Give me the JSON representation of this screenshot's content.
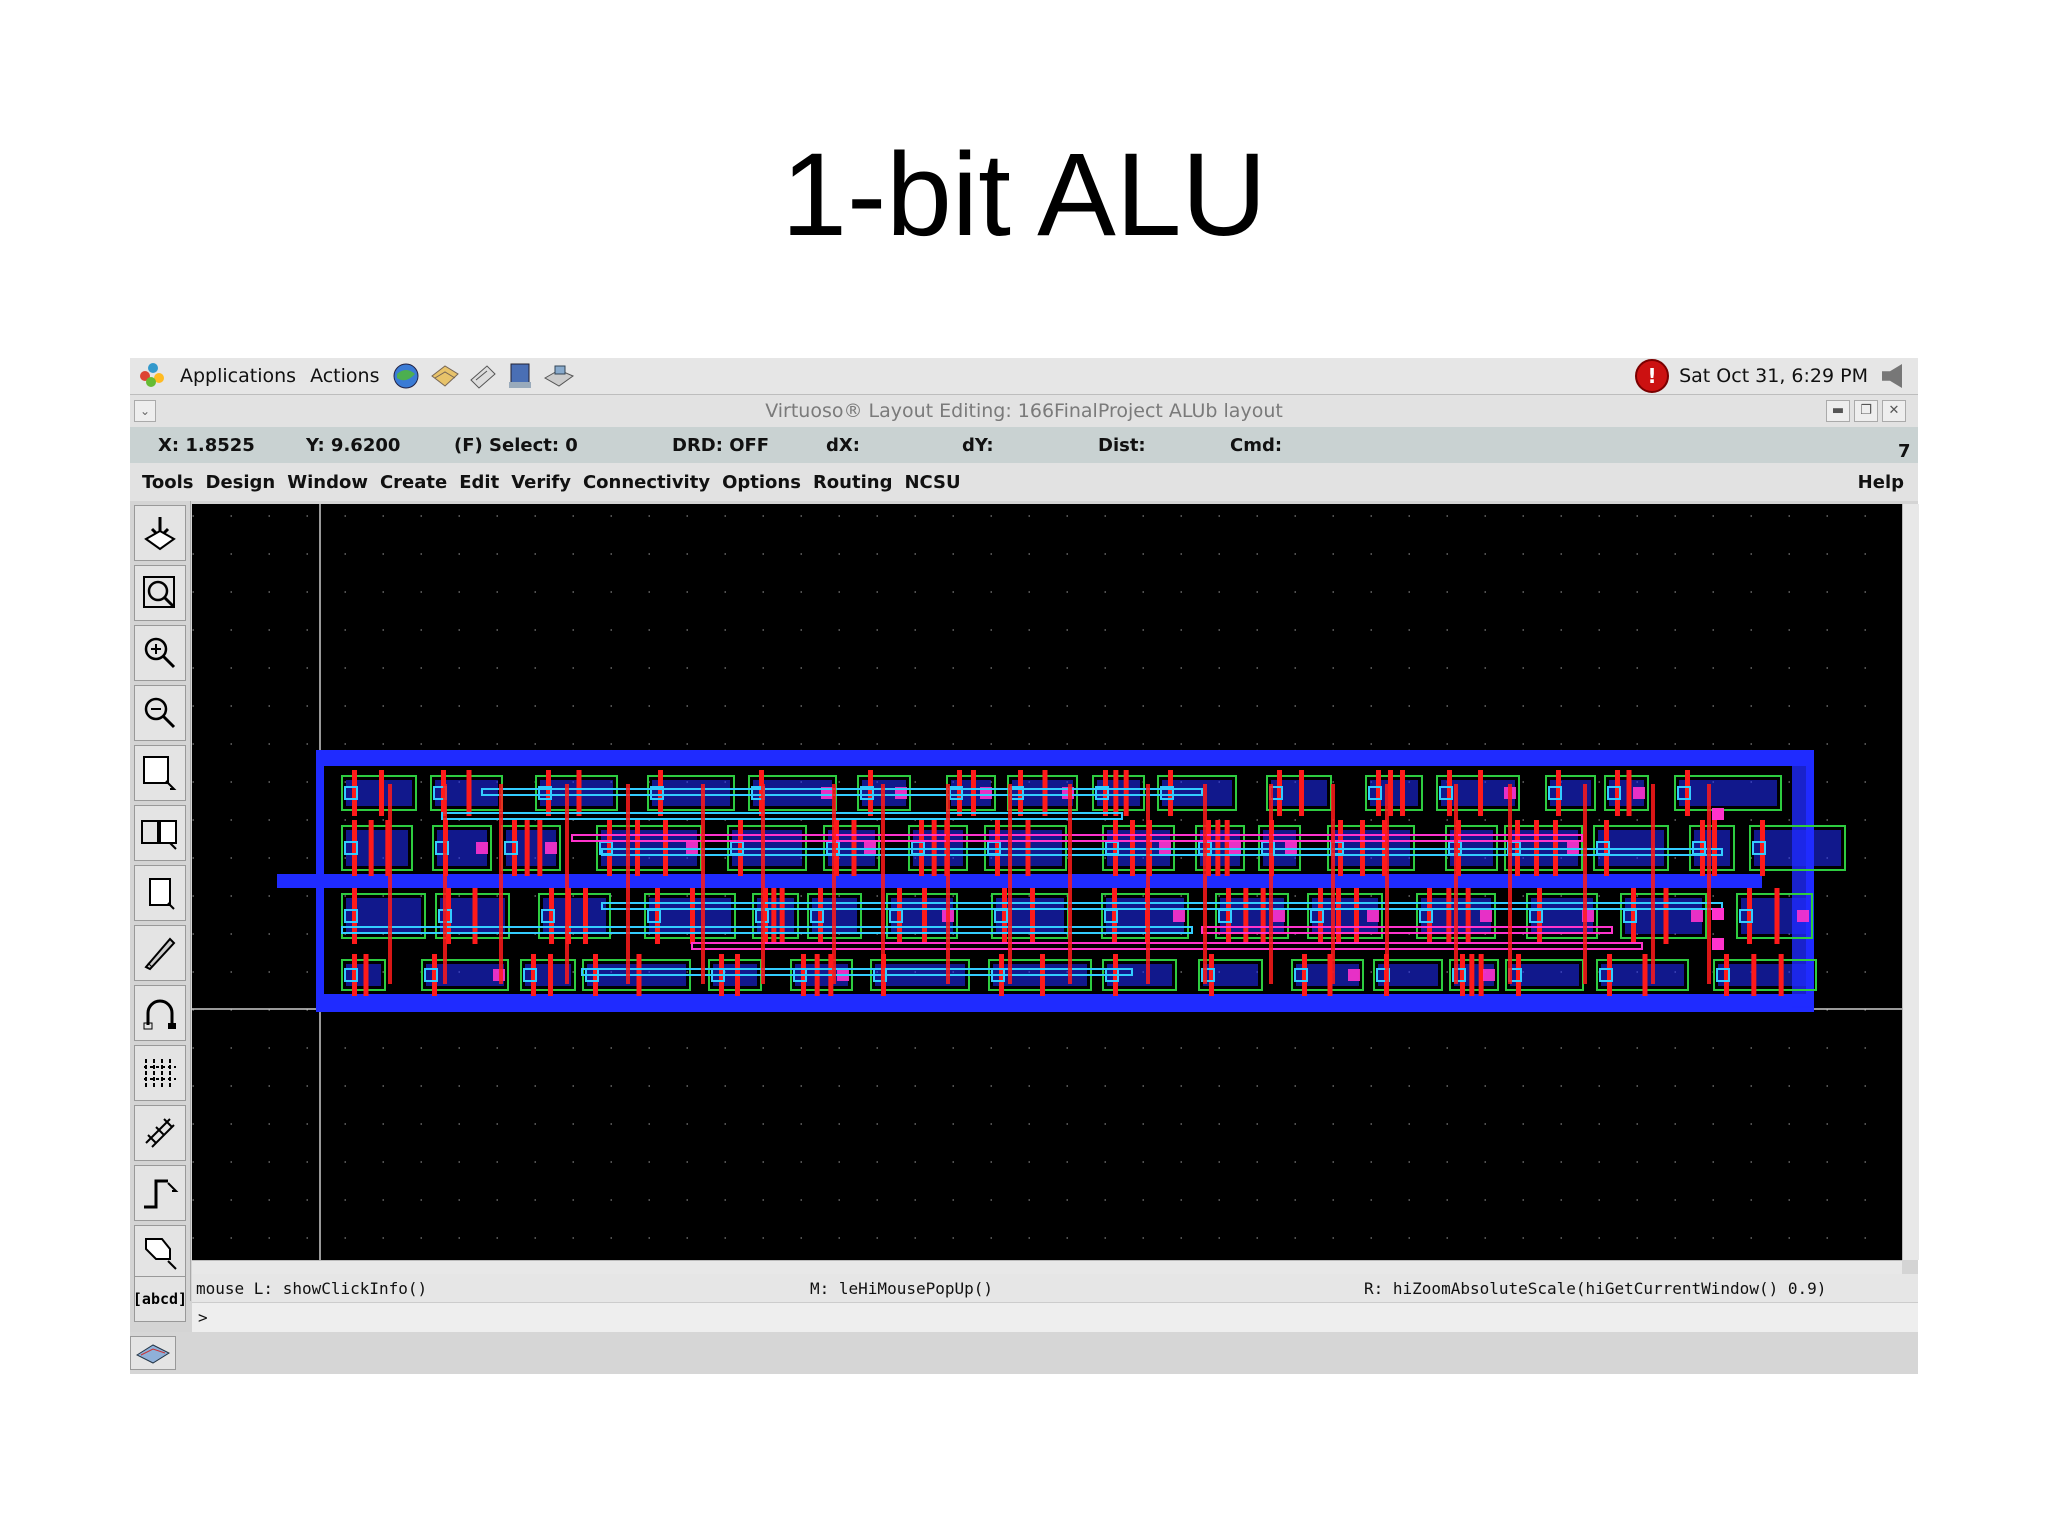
{
  "slide": {
    "title": "1-bit ALU"
  },
  "panel": {
    "applications_label": "Applications",
    "actions_label": "Actions",
    "launchers": [
      "browser-icon",
      "mail-icon",
      "notes-icon",
      "editor-icon",
      "network-icon"
    ],
    "clock": "Sat Oct 31,  6:29 PM"
  },
  "window": {
    "title": "Virtuoso® Layout Editing: 166FinalProject ALUb layout",
    "coords": {
      "x": "X:  1.8525",
      "y": "Y:  9.6200",
      "select": "(F) Select: 0",
      "drd": "DRD: OFF",
      "dx": "dX:",
      "dy": "dY:",
      "dist": "Dist:",
      "cmd": "Cmd:",
      "count": "7"
    },
    "menus": [
      "Tools",
      "Design",
      "Window",
      "Create",
      "Edit",
      "Verify",
      "Connectivity",
      "Options",
      "Routing",
      "NCSU"
    ],
    "help_label": "Help"
  },
  "toolbar": {
    "tools": [
      "save-icon",
      "zoom-fit-icon",
      "zoom-in-icon",
      "zoom-out-icon",
      "stretch-icon",
      "copy-icon",
      "move-icon",
      "delete-icon",
      "undo-icon",
      "property-icon",
      "ruler-icon",
      "path-icon",
      "polygon-icon"
    ],
    "label_tool": "[abcd]"
  },
  "status": {
    "mouse_left": "mouse L:  showClickInfo()",
    "mouse_middle": "M:  leHiMousePopUp()",
    "mouse_right": "R:  hiZoomAbsoluteScale(hiGetCurrentWindow() 0.9)",
    "prompt": ">"
  },
  "colors": {
    "canvas_bg": "#000000",
    "metal1": "#1f2bff",
    "poly": "#ff1a1a",
    "active": "#2ecc40",
    "metal2": "#ff33cc",
    "contact": "#33ccff"
  }
}
